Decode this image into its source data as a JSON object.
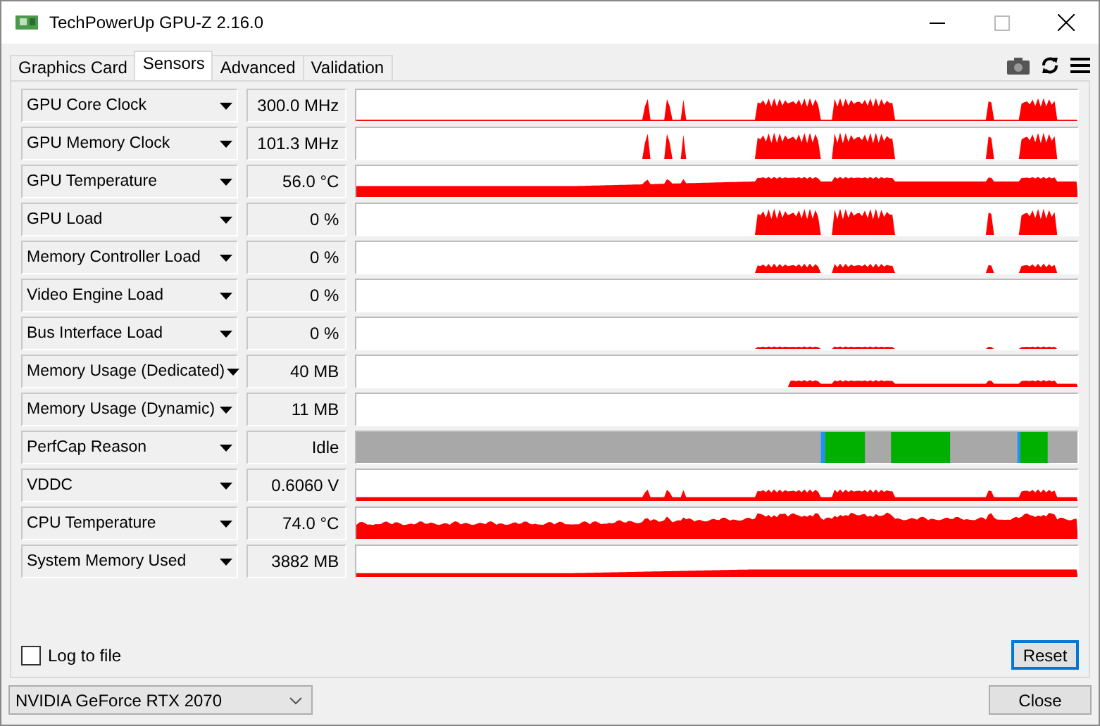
{
  "window": {
    "title": "TechPowerUp GPU-Z 2.16.0"
  },
  "tabs": [
    {
      "label": "Graphics Card",
      "selected": false
    },
    {
      "label": "Sensors",
      "selected": true
    },
    {
      "label": "Advanced",
      "selected": false
    },
    {
      "label": "Validation",
      "selected": false
    }
  ],
  "sensors": [
    {
      "name": "GPU Core Clock",
      "value": "300.0 MHz",
      "kind": "line"
    },
    {
      "name": "GPU Memory Clock",
      "value": "101.3 MHz",
      "kind": "line"
    },
    {
      "name": "GPU Temperature",
      "value": "56.0 °C",
      "kind": "line"
    },
    {
      "name": "GPU Load",
      "value": "0 %",
      "kind": "line"
    },
    {
      "name": "Memory Controller Load",
      "value": "0 %",
      "kind": "line"
    },
    {
      "name": "Video Engine Load",
      "value": "0 %",
      "kind": "line"
    },
    {
      "name": "Bus Interface Load",
      "value": "0 %",
      "kind": "line"
    },
    {
      "name": "Memory Usage (Dedicated)",
      "value": "40 MB",
      "kind": "line"
    },
    {
      "name": "Memory Usage (Dynamic)",
      "value": "11 MB",
      "kind": "line"
    },
    {
      "name": "PerfCap Reason",
      "value": "Idle",
      "kind": "perfcap"
    },
    {
      "name": "VDDC",
      "value": "0.6060 V",
      "kind": "line"
    },
    {
      "name": "CPU Temperature",
      "value": "74.0 °C",
      "kind": "line"
    },
    {
      "name": "System Memory Used",
      "value": "3882 MB",
      "kind": "line"
    }
  ],
  "log_to_file": {
    "label": "Log to file",
    "checked": false
  },
  "reset_button": "Reset",
  "gpu_select": {
    "value": "NVIDIA GeForce RTX 2070"
  },
  "close_button": "Close"
}
